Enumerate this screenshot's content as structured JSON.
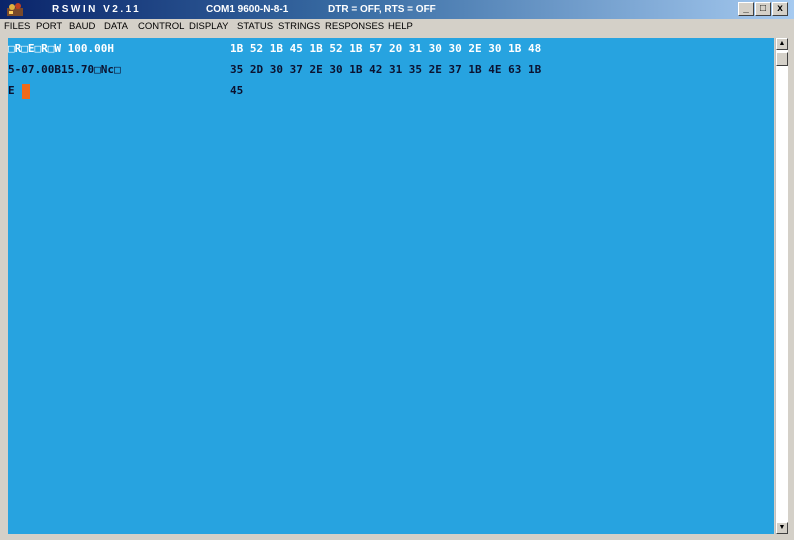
{
  "titlebar": {
    "app": "RSWIN V2.11",
    "port_settings": "COM1 9600-N-8-1",
    "line_status": "DTR = OFF, RTS = OFF"
  },
  "window_controls": {
    "minimize": "_",
    "maximize": "□",
    "close": "x"
  },
  "menu": [
    "FILES",
    "PORT",
    "BAUD",
    "DATA",
    "CONTROL",
    "DISPLAY",
    "STATUS",
    "STRINGS",
    "RESPONSES",
    "HELP"
  ],
  "terminal": {
    "ascii_lines": [
      "□R□E□R□W 100.00H",
      "5-07.00B15.70□Nc□",
      "E"
    ],
    "hex_lines": [
      "1B 52 1B 45 1B 52 1B 57 20 31 30 30 2E 30 1B 48",
      "35 2D 30 37 2E 30 1B 42 31 35 2E 37 1B 4E 63 1B",
      "45"
    ]
  },
  "colors": {
    "terminal_bg": "#27a3e0",
    "cursor": "#f06a1a",
    "title_start": "#0a246a"
  },
  "icons": {
    "app": "app-icon",
    "scroll_up": "arrow-up-icon",
    "scroll_down": "arrow-down-icon"
  }
}
